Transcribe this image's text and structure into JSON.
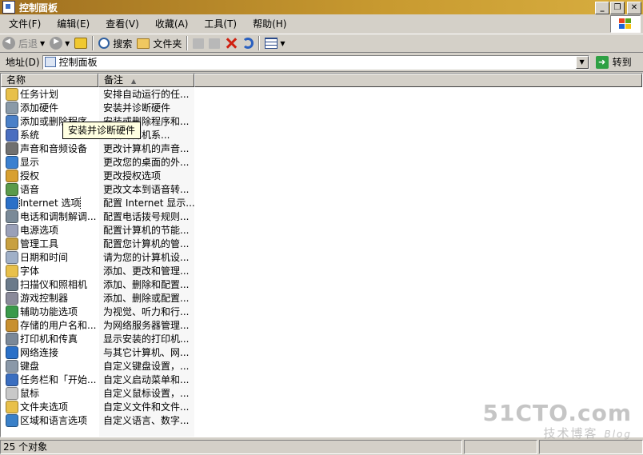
{
  "window": {
    "title": "控制面板",
    "minimize": "_",
    "maximize": "❐",
    "close": "✕"
  },
  "menu": [
    "文件(F)",
    "编辑(E)",
    "查看(V)",
    "收藏(A)",
    "工具(T)",
    "帮助(H)"
  ],
  "toolbar": {
    "back": "后退",
    "search": "搜索",
    "folders": "文件夹"
  },
  "address": {
    "label": "地址(D)",
    "value": "控制面板",
    "go": "转到"
  },
  "columns": {
    "name": "名称",
    "note": "备注"
  },
  "tooltip": "安装并诊断硬件",
  "items": [
    {
      "name": "任务计划",
      "note": "安排自动运行的任...",
      "icon": "scheduled-tasks-icon",
      "color": "#e8c04a"
    },
    {
      "name": "添加硬件",
      "note": "安装并诊断硬件",
      "icon": "add-hardware-icon",
      "color": "#8a9aa8"
    },
    {
      "name": "添加或删除程序",
      "note": "安装或删除程序和...",
      "icon": "add-remove-programs-icon",
      "color": "#4a80c8"
    },
    {
      "name": "系统",
      "note": "查看计算机系...",
      "icon": "system-icon",
      "color": "#4a6ec0"
    },
    {
      "name": "声音和音频设备",
      "note": "更改计算机的声音...",
      "icon": "sound-icon",
      "color": "#707070"
    },
    {
      "name": "显示",
      "note": "更改您的桌面的外...",
      "icon": "display-icon",
      "color": "#3a80d0"
    },
    {
      "name": "授权",
      "note": "更改授权选项",
      "icon": "licensing-icon",
      "color": "#d8a030"
    },
    {
      "name": "语音",
      "note": "更改文本到语音转...",
      "icon": "speech-icon",
      "color": "#5a9a4a"
    },
    {
      "name": "Internet 选项",
      "note": "配置 Internet 显示...",
      "icon": "internet-options-icon",
      "color": "#2a70c8"
    },
    {
      "name": "电话和调制解调...",
      "note": "配置电话拨号规则...",
      "icon": "phone-modem-icon",
      "color": "#7a8a98"
    },
    {
      "name": "电源选项",
      "note": "配置计算机的节能...",
      "icon": "power-options-icon",
      "color": "#9aa0b8"
    },
    {
      "name": "管理工具",
      "note": "配置您计算机的管...",
      "icon": "admin-tools-icon",
      "color": "#c8a040"
    },
    {
      "name": "日期和时间",
      "note": "请为您的计算机设...",
      "icon": "date-time-icon",
      "color": "#a0b0c8"
    },
    {
      "name": "字体",
      "note": "添加、更改和管理...",
      "icon": "fonts-icon",
      "color": "#e8c04a"
    },
    {
      "name": "扫描仪和照相机",
      "note": "添加、删除和配置...",
      "icon": "scanner-camera-icon",
      "color": "#6a7a8a"
    },
    {
      "name": "游戏控制器",
      "note": "添加、删除或配置...",
      "icon": "game-controller-icon",
      "color": "#8a8a9a"
    },
    {
      "name": "辅助功能选项",
      "note": "为视觉、听力和行...",
      "icon": "accessibility-icon",
      "color": "#3a9a4a"
    },
    {
      "name": "存储的用户名和...",
      "note": "为网络服务器管理...",
      "icon": "stored-credentials-icon",
      "color": "#c89030"
    },
    {
      "name": "打印机和传真",
      "note": "显示安装的打印机...",
      "icon": "printer-fax-icon",
      "color": "#7a8898"
    },
    {
      "name": "网络连接",
      "note": "与其它计算机、网...",
      "icon": "network-connections-icon",
      "color": "#2a70c8"
    },
    {
      "name": "键盘",
      "note": "自定义键盘设置，...",
      "icon": "keyboard-icon",
      "color": "#8a98a8"
    },
    {
      "name": "任务栏和「开始...",
      "note": "自定义启动菜单和...",
      "icon": "taskbar-start-icon",
      "color": "#3a6ec0"
    },
    {
      "name": "鼠标",
      "note": "自定义鼠标设置，...",
      "icon": "mouse-icon",
      "color": "#c8c8c8"
    },
    {
      "name": "文件夹选项",
      "note": "自定义文件和文件...",
      "icon": "folder-options-icon",
      "color": "#e8c04a"
    },
    {
      "name": "区域和语言选项",
      "note": "自定义语言、数字...",
      "icon": "regional-language-icon",
      "color": "#3a80c8"
    }
  ],
  "status": {
    "count": "25 个对象"
  },
  "watermark": {
    "brand": "51CTO.com",
    "sub": "技术博客",
    "blog": "Blog"
  }
}
